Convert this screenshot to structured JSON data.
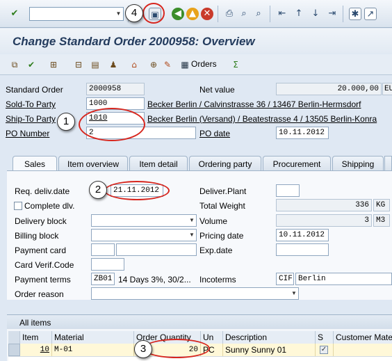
{
  "toolbar": {
    "command_field_value": "",
    "icons": [
      "enter-icon",
      "save-icon",
      "back-icon",
      "exit-icon",
      "cancel-icon",
      "print-icon",
      "find-icon",
      "find-next-icon",
      "first-page-icon",
      "previous-page-icon",
      "next-page-icon",
      "last-page-icon",
      "create-session-icon",
      "shortcut-icon"
    ]
  },
  "title": "Change Standard Order 2000958: Overview",
  "app_toolbar": {
    "orders_label": "Orders"
  },
  "header": {
    "standard_order_label": "Standard Order",
    "standard_order_value": "2000958",
    "net_value_label": "Net value",
    "net_value": "20.000,00",
    "currency": "EU",
    "sold_to_label": "Sold-To Party",
    "sold_to_value": "1000",
    "sold_to_text": "Becker Berlin / Calvinstrasse 36 / 13467 Berlin-Hermsdorf",
    "ship_to_label": "Ship-To Party",
    "ship_to_value": "1010",
    "ship_to_text": "Becker Berlin (Versand) / Beatestrasse 4 / 13505 Berlin-Konra",
    "po_number_label": "PO Number",
    "po_number_value": "2",
    "po_date_label": "PO date",
    "po_date_value": "10.11.2012"
  },
  "tabs": [
    "Sales",
    "Item overview",
    "Item detail",
    "Ordering party",
    "Procurement",
    "Shipping"
  ],
  "sales": {
    "req_deliv_date_label": "Req. deliv.date",
    "req_deliv_date_value": "21.11.2012",
    "deliver_plant_label": "Deliver.Plant",
    "deliver_plant_value": "",
    "complete_dlv_label": "Complete dlv.",
    "total_weight_label": "Total Weight",
    "total_weight_value": "336",
    "total_weight_unit": "KG",
    "delivery_block_label": "Delivery block",
    "volume_label": "Volume",
    "volume_value": "3",
    "volume_unit": "M3",
    "billing_block_label": "Billing block",
    "pricing_date_label": "Pricing date",
    "pricing_date_value": "10.11.2012",
    "payment_card_label": "Payment card",
    "exp_date_label": "Exp.date",
    "card_verif_label": "Card Verif.Code",
    "payment_terms_label": "Payment terms",
    "payment_terms_code": "ZB01",
    "payment_terms_text": "14 Days 3%, 30/2...",
    "incoterms_label": "Incoterms",
    "incoterms_code": "CIF",
    "incoterms_place": "Berlin",
    "order_reason_label": "Order reason"
  },
  "items": {
    "title": "All items",
    "columns": [
      "Item",
      "Material",
      "Order Quantity",
      "Un",
      "Description",
      "S",
      "Customer Mate"
    ],
    "rows": [
      {
        "item": "10",
        "material": "M-01",
        "qty": "20",
        "unit": "PC",
        "description": "Sunny Sunny 01",
        "s_checked": true,
        "customer_material": ""
      }
    ]
  },
  "callouts": [
    "1",
    "2",
    "3",
    "4"
  ]
}
